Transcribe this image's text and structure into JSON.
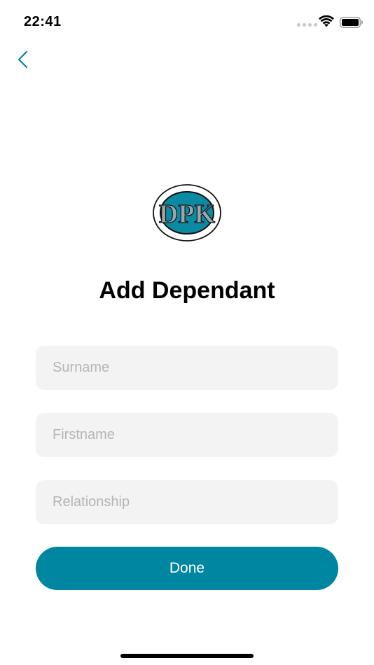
{
  "status_bar": {
    "time": "22:41"
  },
  "icons": {
    "back": "chevron-left-icon",
    "wifi": "wifi-icon",
    "battery": "battery-icon",
    "logo": "dpk-logo"
  },
  "colors": {
    "accent": "#0086a0",
    "field_bg": "#f3f3f3",
    "placeholder": "#b5b5b5"
  },
  "page": {
    "title": "Add Dependant"
  },
  "form": {
    "surname": {
      "value": "",
      "placeholder": "Surname"
    },
    "firstname": {
      "value": "",
      "placeholder": "Firstname"
    },
    "relationship": {
      "value": "",
      "placeholder": "Relationship"
    },
    "done_label": "Done"
  },
  "logo": {
    "text": "DPK"
  }
}
